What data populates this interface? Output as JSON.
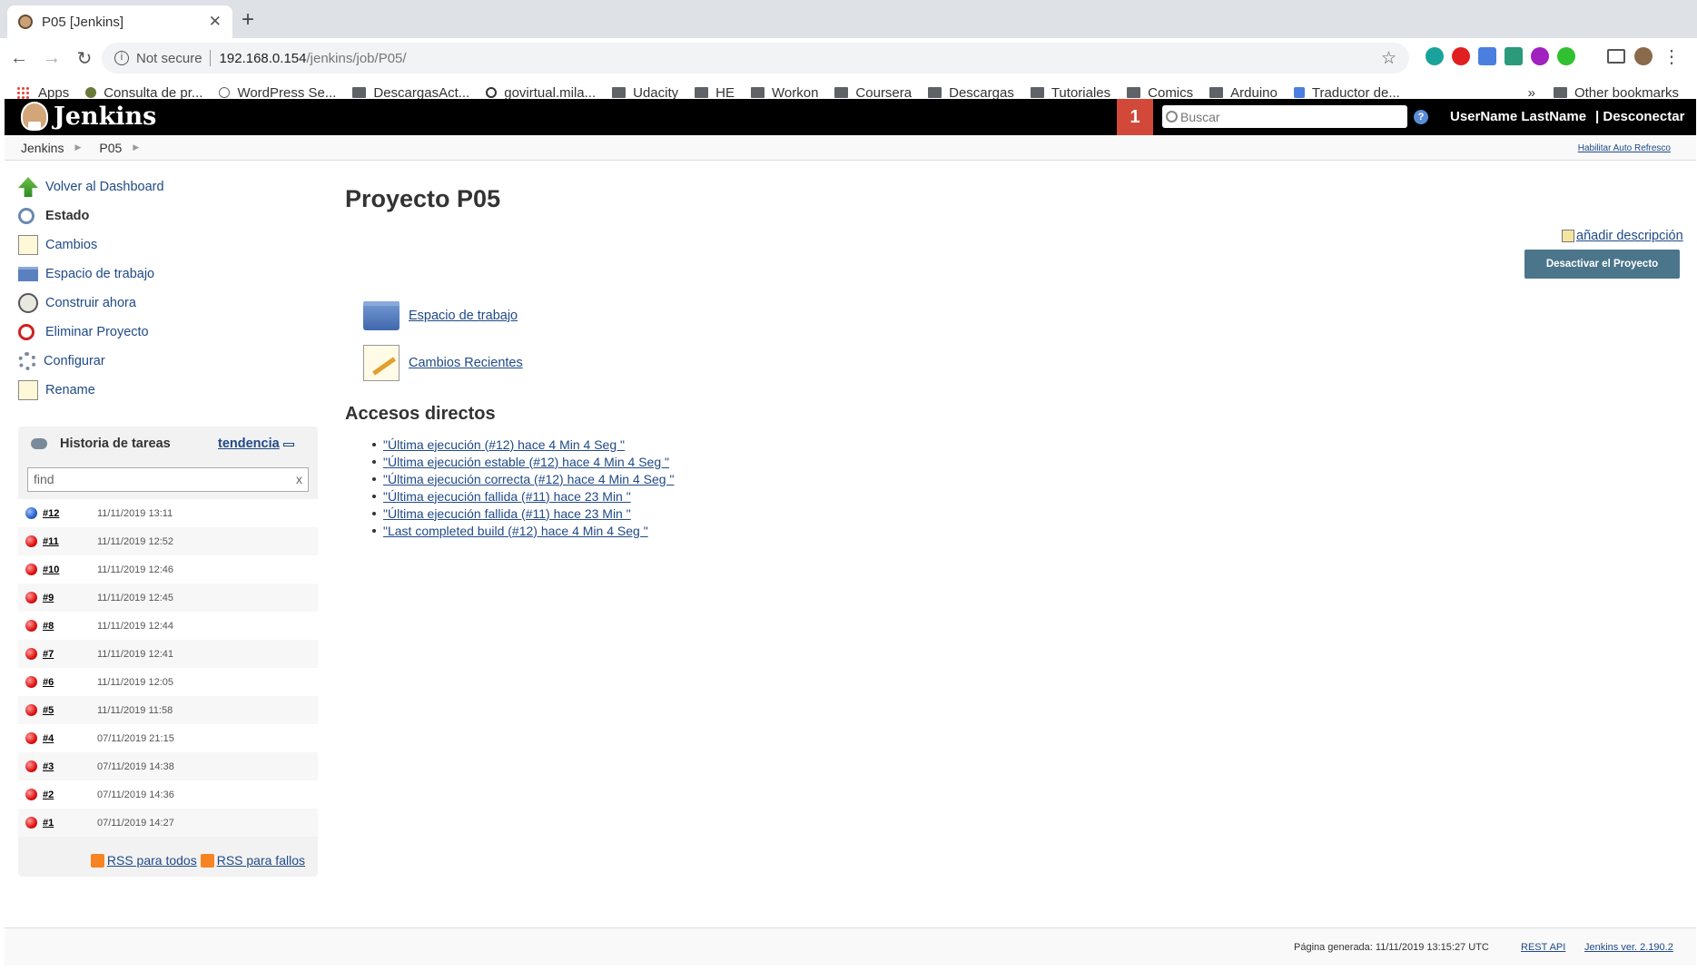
{
  "browser": {
    "tab_title": "P05 [Jenkins]",
    "url_security": "Not secure",
    "url_host": "192.168.0.154",
    "url_path": "/jenkins/job/P05/",
    "bookmarks": [
      "Apps",
      "Consulta de pr...",
      "WordPress Se...",
      "DescargasAct...",
      "govirtual.mila...",
      "Udacity",
      "HE",
      "Workon",
      "Coursera",
      "Descargas",
      "Tutoriales",
      "Comics",
      "Arduino",
      "Traductor de..."
    ],
    "overflow": "»",
    "other_bookmarks": "Other bookmarks"
  },
  "header": {
    "logo_text": "Jenkins",
    "notifications": "1",
    "search_placeholder": "Buscar",
    "user": "UserName LastName",
    "logout": "| Desconectar"
  },
  "breadcrumb": {
    "items": [
      "Jenkins",
      "P05"
    ],
    "auto_refresh": "Habilitar Auto Refresco"
  },
  "side_tasks": [
    {
      "label": "Volver al Dashboard",
      "icon": "up-arrow-icon"
    },
    {
      "label": "Estado",
      "icon": "magnifier-icon"
    },
    {
      "label": "Cambios",
      "icon": "notepad-icon"
    },
    {
      "label": "Espacio de trabajo",
      "icon": "folder-icon"
    },
    {
      "label": "Construir ahora",
      "icon": "clock-icon"
    },
    {
      "label": "Eliminar Proyecto",
      "icon": "no-entry-icon"
    },
    {
      "label": "Configurar",
      "icon": "gear-icon"
    },
    {
      "label": "Rename",
      "icon": "notepad-icon"
    }
  ],
  "build_history": {
    "title": "Historia de tareas",
    "trend": "tendencia",
    "filter_placeholder": "find",
    "clear": "x",
    "builds": [
      {
        "num": "#12",
        "date": "11/11/2019 13:11",
        "status": "blue"
      },
      {
        "num": "#11",
        "date": "11/11/2019 12:52",
        "status": "red"
      },
      {
        "num": "#10",
        "date": "11/11/2019 12:46",
        "status": "red"
      },
      {
        "num": "#9",
        "date": "11/11/2019 12:45",
        "status": "red"
      },
      {
        "num": "#8",
        "date": "11/11/2019 12:44",
        "status": "red"
      },
      {
        "num": "#7",
        "date": "11/11/2019 12:41",
        "status": "red"
      },
      {
        "num": "#6",
        "date": "11/11/2019 12:05",
        "status": "red"
      },
      {
        "num": "#5",
        "date": "11/11/2019 11:58",
        "status": "red"
      },
      {
        "num": "#4",
        "date": "07/11/2019 21:15",
        "status": "red"
      },
      {
        "num": "#3",
        "date": "07/11/2019 14:38",
        "status": "red"
      },
      {
        "num": "#2",
        "date": "07/11/2019 14:36",
        "status": "red"
      },
      {
        "num": "#1",
        "date": "07/11/2019 14:27",
        "status": "red"
      }
    ],
    "rss_all": "RSS para todos",
    "rss_failed": "RSS para fallos"
  },
  "main": {
    "title": "Proyecto P05",
    "add_description": "añadir descripción",
    "disable_button": "Desactivar el Proyecto",
    "workspace_link": "Espacio de trabajo",
    "recent_changes_link": "Cambios Recientes",
    "shortcuts_title": "Accesos directos",
    "shortcuts": [
      "\"Última ejecución (#12) hace 4 Min 4 Seg \"",
      "\"Última ejecución estable (#12) hace 4 Min 4 Seg \"",
      "\"Última ejecución correcta (#12) hace 4 Min 4 Seg \"",
      "\"Última ejecución fallida (#11) hace 23 Min \"",
      "\"Última ejecución fallida (#11) hace 23 Min \"",
      "\"Last completed build (#12) hace 4 Min 4 Seg \""
    ]
  },
  "footer": {
    "generated": "Página generada: 11/11/2019 13:15:27 UTC",
    "rest_api": "REST API",
    "version": "Jenkins ver. 2.190.2"
  }
}
